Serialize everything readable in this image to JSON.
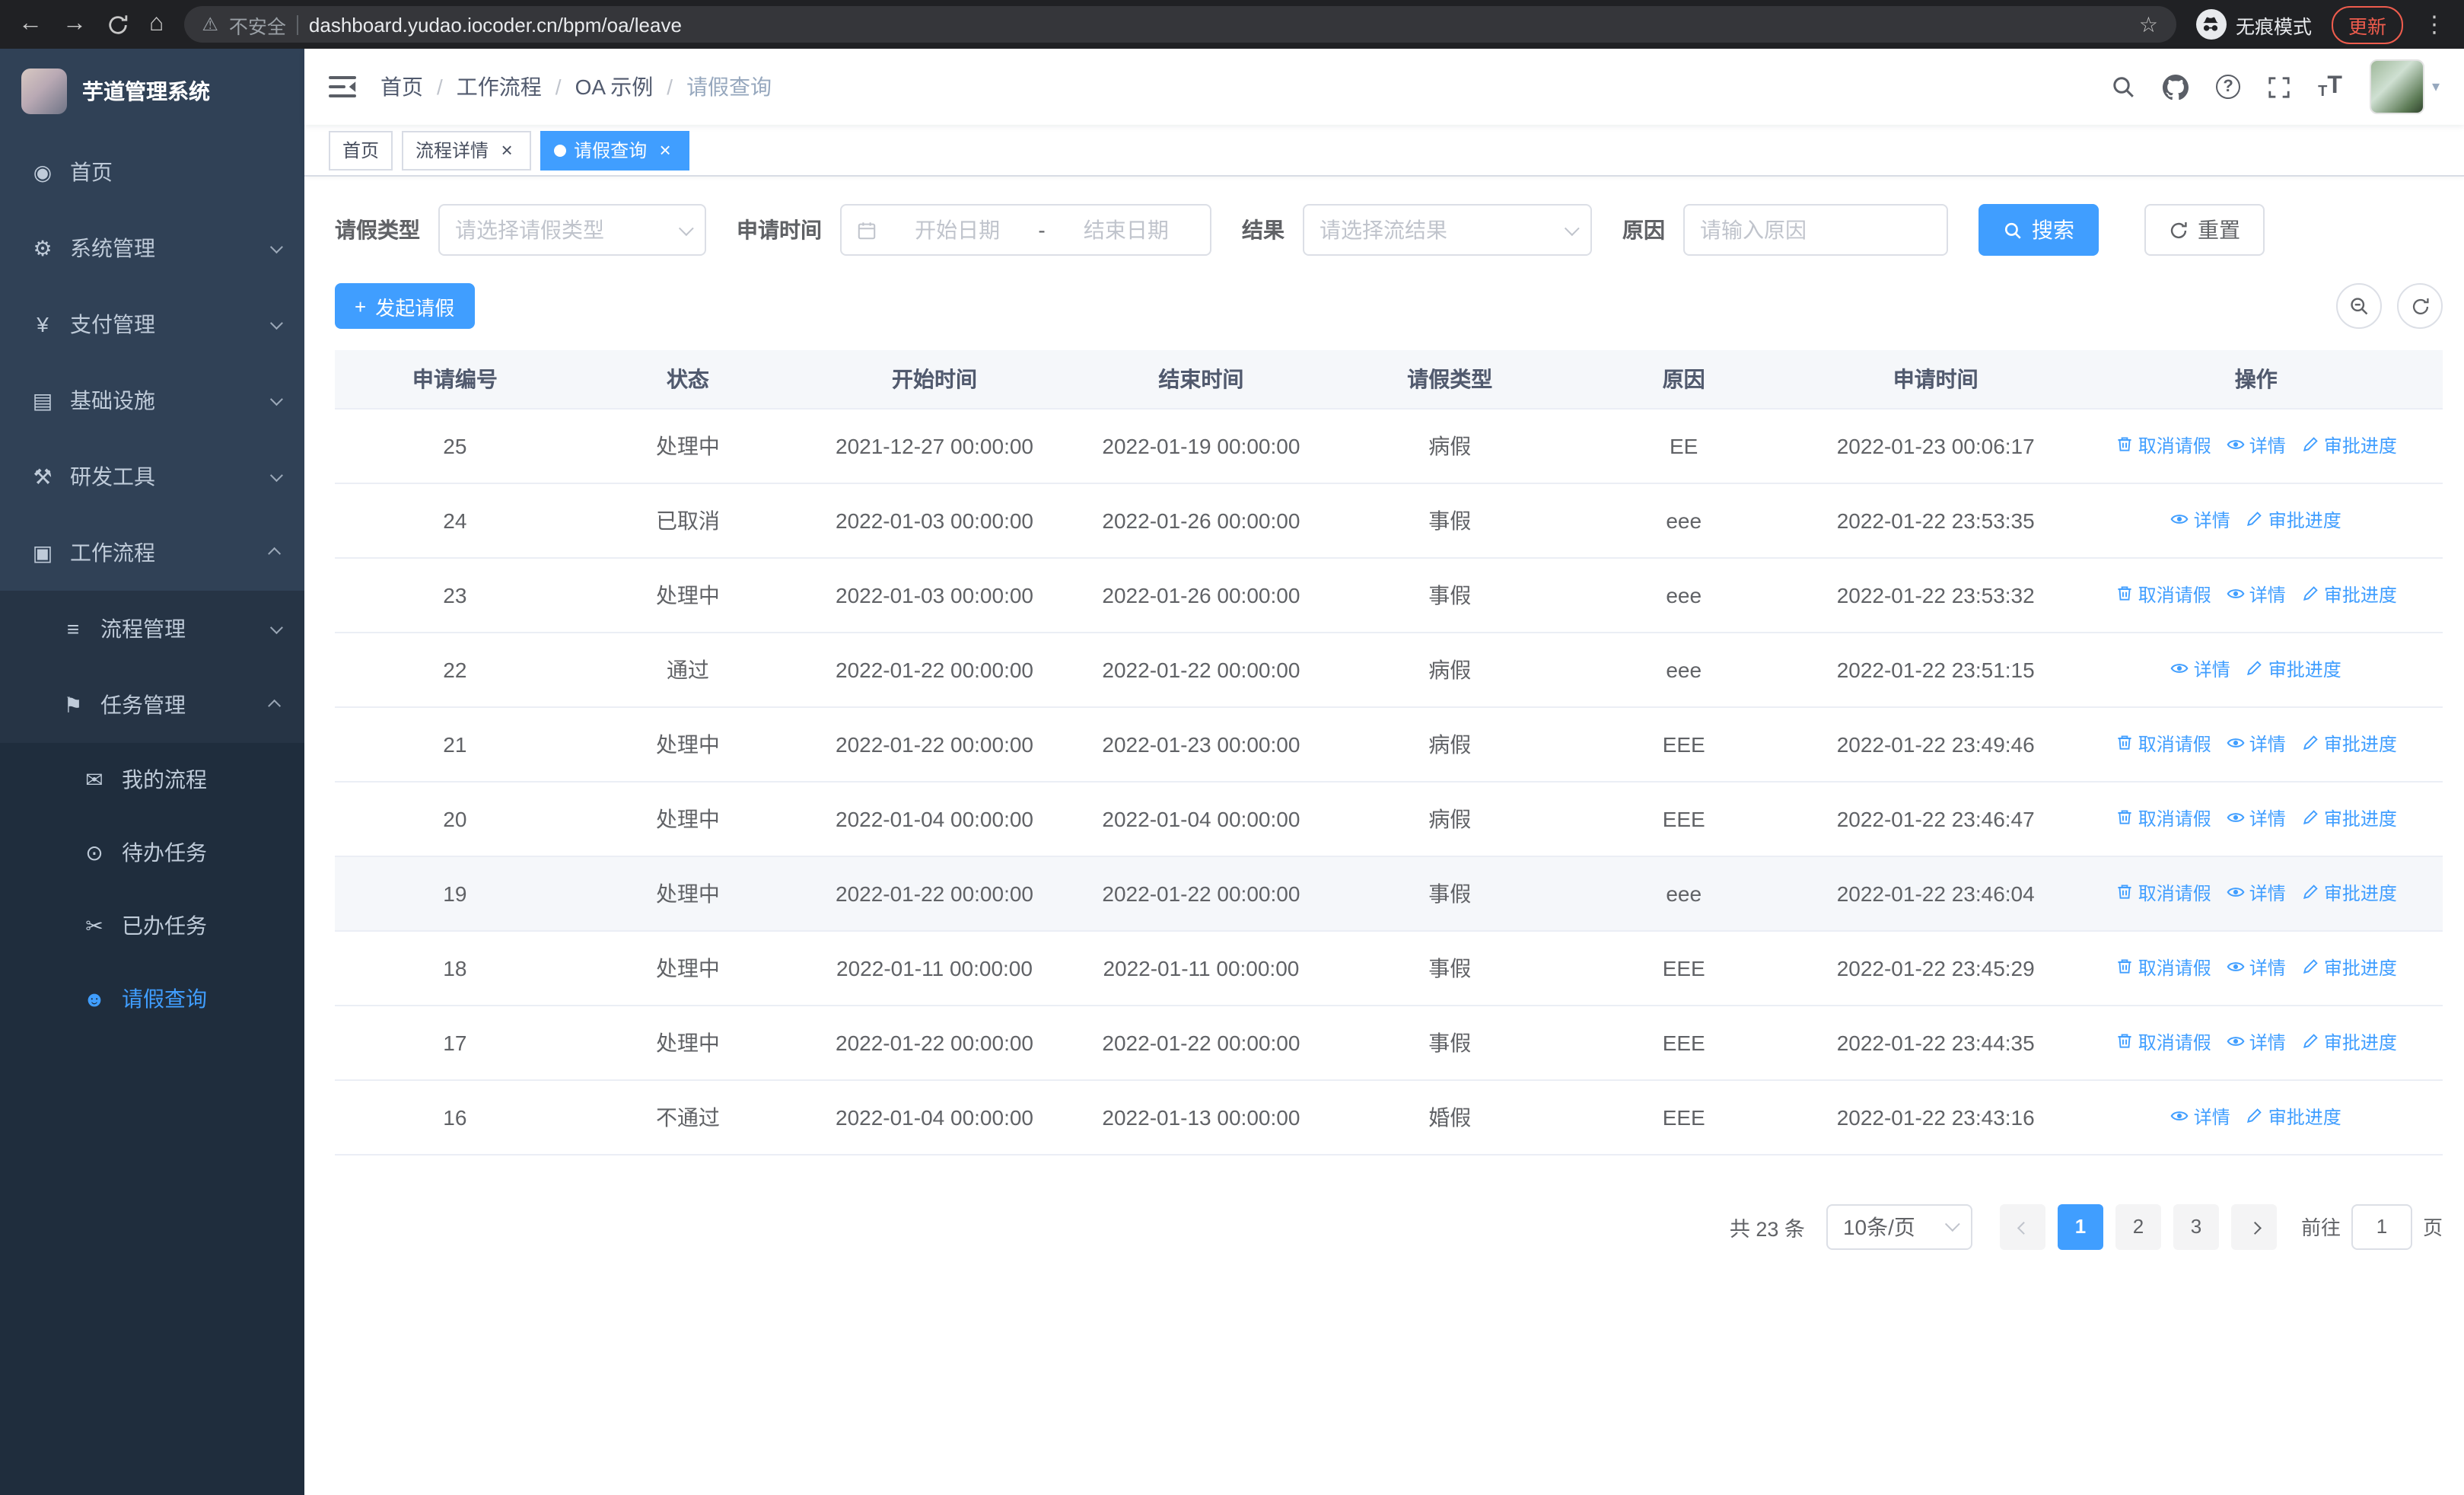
{
  "browser": {
    "security_warning": "不安全",
    "url": "dashboard.yudao.iocoder.cn/bpm/oa/leave",
    "incognito_label": "无痕模式",
    "update_label": "更新"
  },
  "sidebar": {
    "app_title": "芋道管理系统",
    "menu": [
      {
        "label": "首页",
        "icon": "dashboard-icon",
        "level": 1
      },
      {
        "label": "系统管理",
        "icon": "gear-icon",
        "level": 1,
        "chevron": "down"
      },
      {
        "label": "支付管理",
        "icon": "payment-icon",
        "level": 1,
        "chevron": "down"
      },
      {
        "label": "基础设施",
        "icon": "infrastructure-icon",
        "level": 1,
        "chevron": "down"
      },
      {
        "label": "研发工具",
        "icon": "devtools-icon",
        "level": 1,
        "chevron": "down"
      },
      {
        "label": "工作流程",
        "icon": "workflow-icon",
        "level": 1,
        "chevron": "up"
      },
      {
        "label": "流程管理",
        "icon": "process-icon",
        "level": 2,
        "chevron": "down"
      },
      {
        "label": "任务管理",
        "icon": "task-icon",
        "level": 2,
        "chevron": "up"
      },
      {
        "label": "我的流程",
        "icon": "my-process-icon",
        "level": 3
      },
      {
        "label": "待办任务",
        "icon": "todo-icon",
        "level": 3
      },
      {
        "label": "已办任务",
        "icon": "done-icon",
        "level": 3
      },
      {
        "label": "请假查询",
        "icon": "leave-icon",
        "level": 3,
        "active": true
      }
    ]
  },
  "navbar": {
    "breadcrumb": [
      "首页",
      "工作流程",
      "OA 示例",
      "请假查询"
    ]
  },
  "tabs": [
    {
      "label": "首页"
    },
    {
      "label": "流程详情",
      "closable": true
    },
    {
      "label": "请假查询",
      "closable": true,
      "active": true
    }
  ],
  "filters": {
    "leave_type": {
      "label": "请假类型",
      "placeholder": "请选择请假类型"
    },
    "apply_time": {
      "label": "申请时间",
      "start_placeholder": "开始日期",
      "separator": "-",
      "end_placeholder": "结束日期"
    },
    "result": {
      "label": "结果",
      "placeholder": "请选择流结果"
    },
    "reason": {
      "label": "原因",
      "placeholder": "请输入原因"
    },
    "search_label": "搜索",
    "reset_label": "重置"
  },
  "toolbar": {
    "create_label": "发起请假"
  },
  "table": {
    "columns": [
      "申请编号",
      "状态",
      "开始时间",
      "结束时间",
      "请假类型",
      "原因",
      "申请时间",
      "操作"
    ],
    "action_defs": {
      "cancel": {
        "label": "取消请假",
        "icon": "trash-icon"
      },
      "detail": {
        "label": "详情",
        "icon": "eye-icon"
      },
      "progress": {
        "label": "审批进度",
        "icon": "edit-icon"
      }
    },
    "rows": [
      {
        "id": "25",
        "status": "处理中",
        "start": "2021-12-27 00:00:00",
        "end": "2022-01-19 00:00:00",
        "type": "病假",
        "reason": "EE",
        "apply_time": "2022-01-23 00:06:17",
        "actions": [
          "cancel",
          "detail",
          "progress"
        ]
      },
      {
        "id": "24",
        "status": "已取消",
        "start": "2022-01-03 00:00:00",
        "end": "2022-01-26 00:00:00",
        "type": "事假",
        "reason": "eee",
        "apply_time": "2022-01-22 23:53:35",
        "actions": [
          "detail",
          "progress"
        ]
      },
      {
        "id": "23",
        "status": "处理中",
        "start": "2022-01-03 00:00:00",
        "end": "2022-01-26 00:00:00",
        "type": "事假",
        "reason": "eee",
        "apply_time": "2022-01-22 23:53:32",
        "actions": [
          "cancel",
          "detail",
          "progress"
        ]
      },
      {
        "id": "22",
        "status": "通过",
        "start": "2022-01-22 00:00:00",
        "end": "2022-01-22 00:00:00",
        "type": "病假",
        "reason": "eee",
        "apply_time": "2022-01-22 23:51:15",
        "actions": [
          "detail",
          "progress"
        ]
      },
      {
        "id": "21",
        "status": "处理中",
        "start": "2022-01-22 00:00:00",
        "end": "2022-01-23 00:00:00",
        "type": "病假",
        "reason": "EEE",
        "apply_time": "2022-01-22 23:49:46",
        "actions": [
          "cancel",
          "detail",
          "progress"
        ]
      },
      {
        "id": "20",
        "status": "处理中",
        "start": "2022-01-04 00:00:00",
        "end": "2022-01-04 00:00:00",
        "type": "病假",
        "reason": "EEE",
        "apply_time": "2022-01-22 23:46:47",
        "actions": [
          "cancel",
          "detail",
          "progress"
        ]
      },
      {
        "id": "19",
        "status": "处理中",
        "start": "2022-01-22 00:00:00",
        "end": "2022-01-22 00:00:00",
        "type": "事假",
        "reason": "eee",
        "apply_time": "2022-01-22 23:46:04",
        "actions": [
          "cancel",
          "detail",
          "progress"
        ],
        "hover": true
      },
      {
        "id": "18",
        "status": "处理中",
        "start": "2022-01-11 00:00:00",
        "end": "2022-01-11 00:00:00",
        "type": "事假",
        "reason": "EEE",
        "apply_time": "2022-01-22 23:45:29",
        "actions": [
          "cancel",
          "detail",
          "progress"
        ]
      },
      {
        "id": "17",
        "status": "处理中",
        "start": "2022-01-22 00:00:00",
        "end": "2022-01-22 00:00:00",
        "type": "事假",
        "reason": "EEE",
        "apply_time": "2022-01-22 23:44:35",
        "actions": [
          "cancel",
          "detail",
          "progress"
        ]
      },
      {
        "id": "16",
        "status": "不通过",
        "start": "2022-01-04 00:00:00",
        "end": "2022-01-13 00:00:00",
        "type": "婚假",
        "reason": "EEE",
        "apply_time": "2022-01-22 23:43:16",
        "actions": [
          "detail",
          "progress"
        ]
      }
    ]
  },
  "pagination": {
    "total_label": "共 23 条",
    "page_size": "10条/页",
    "pages": [
      "1",
      "2",
      "3"
    ],
    "active_page": "1",
    "goto_label": "前往",
    "goto_value": "1",
    "page_unit": "页"
  },
  "colors": {
    "accent": "#409eff",
    "sidebar_bg": "#304156",
    "submenu_bg": "#263445",
    "submenu_deep_bg": "#1f2d3d"
  }
}
